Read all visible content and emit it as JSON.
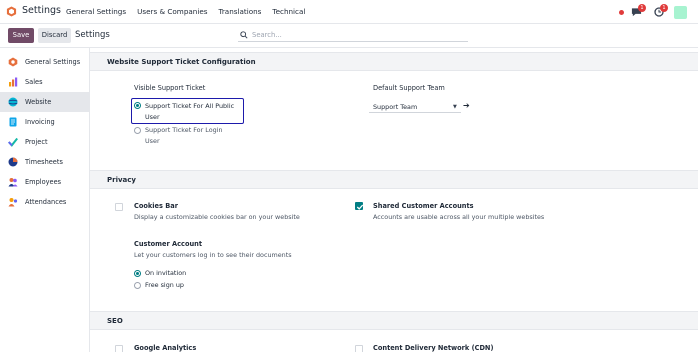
{
  "app": {
    "title": "Settings",
    "menu": [
      "General Settings",
      "Users & Companies",
      "Translations",
      "Technical"
    ],
    "chat_badge": "1",
    "activity_badge": "1",
    "brand_color": "#714b67",
    "accent_color": "#017e84"
  },
  "control": {
    "save_label": "Save",
    "discard_label": "Discard",
    "breadcrumb": "Settings",
    "search_placeholder": "Search..."
  },
  "sidebar": {
    "items": [
      {
        "label": "General Settings",
        "icon": "general-settings-icon",
        "active": false
      },
      {
        "label": "Sales",
        "icon": "sales-icon",
        "active": false
      },
      {
        "label": "Website",
        "icon": "website-icon",
        "active": true
      },
      {
        "label": "Invoicing",
        "icon": "invoicing-icon",
        "active": false
      },
      {
        "label": "Project",
        "icon": "project-icon",
        "active": false
      },
      {
        "label": "Timesheets",
        "icon": "timesheets-icon",
        "active": false
      },
      {
        "label": "Employees",
        "icon": "employees-icon",
        "active": false
      },
      {
        "label": "Attendances",
        "icon": "attendances-icon",
        "active": false
      }
    ]
  },
  "support": {
    "section_title": "Website Support Ticket Configuration",
    "visible_label": "Visible Support Ticket",
    "option_public_line1": "Support Ticket For All Public",
    "option_public_line2": "User",
    "option_login_line1": "Support Ticket For Login",
    "option_login_line2": "User",
    "selected": "public",
    "team_label": "Default Support Team",
    "team_value": "Support Team"
  },
  "privacy": {
    "section_title": "Privacy",
    "cookies_title": "Cookies Bar",
    "cookies_desc": "Display a customizable cookies bar on your website",
    "cookies_checked": false,
    "shared_title": "Shared Customer Accounts",
    "shared_desc": "Accounts are usable across all your multiple websites",
    "shared_checked": true,
    "account_title": "Customer Account",
    "account_desc": "Let your customers log in to see their documents",
    "opt_invitation": "On invitation",
    "opt_signup": "Free sign up",
    "account_selected": "invitation"
  },
  "seo": {
    "section_title": "SEO",
    "analytics_title": "Google Analytics",
    "cdn_title": "Content Delivery Network (CDN)"
  }
}
